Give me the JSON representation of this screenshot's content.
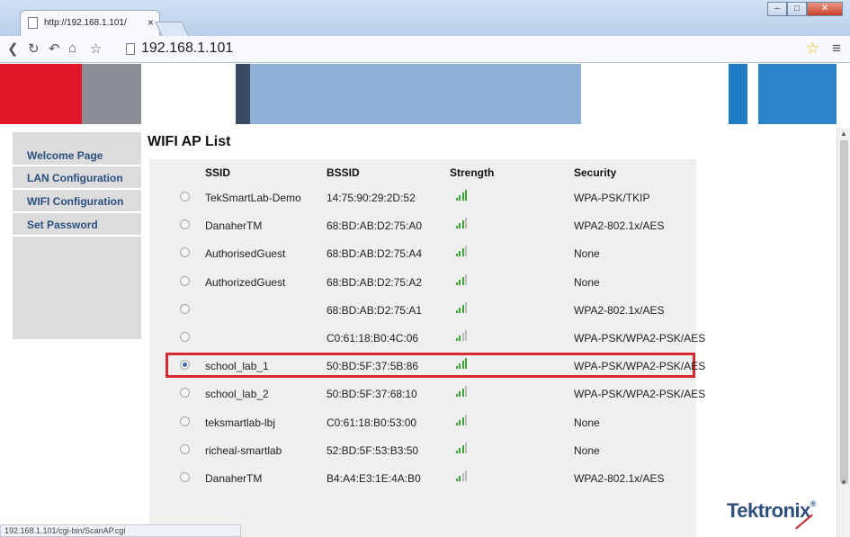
{
  "browser": {
    "tab_title": "http://192.168.1.101/",
    "tab_close": "×",
    "url": "192.168.1.101",
    "status_url": "192.168.1.101/cgi-bin/ScanAP.cgi",
    "icons": [
      "back-icon",
      "reload-icon",
      "undo-icon",
      "home-icon",
      "bookmark-icon",
      "page-icon",
      "star-icon",
      "menu-icon"
    ]
  },
  "sidebar": {
    "items": [
      {
        "label": "Welcome Page"
      },
      {
        "label": "LAN Configuration"
      },
      {
        "label": "WIFI Configuration"
      },
      {
        "label": "Set Password"
      }
    ]
  },
  "page": {
    "title": "WIFI AP List"
  },
  "table": {
    "headers": {
      "ssid": "SSID",
      "bssid": "BSSID",
      "strength": "Strength",
      "security": "Security"
    },
    "rows": [
      {
        "ssid": "TekSmartLab-Demo",
        "bssid": "14:75:90:29:2D:52",
        "strength_bars": 4,
        "security": "WPA-PSK/TKIP",
        "selected": false
      },
      {
        "ssid": "DanaherTM",
        "bssid": "68:BD:AB:D2:75:A0",
        "strength_bars": 3,
        "security": "WPA2-802.1x/AES",
        "selected": false
      },
      {
        "ssid": "AuthorisedGuest",
        "bssid": "68:BD:AB:D2:75:A4",
        "strength_bars": 3,
        "security": "None",
        "selected": false
      },
      {
        "ssid": "AuthorizedGuest",
        "bssid": "68:BD:AB:D2:75:A2",
        "strength_bars": 3,
        "security": "None",
        "selected": false
      },
      {
        "ssid": "",
        "bssid": "68:BD:AB:D2:75:A1",
        "strength_bars": 3,
        "security": "WPA2-802.1x/AES",
        "selected": false
      },
      {
        "ssid": "",
        "bssid": "C0:61:18:B0:4C:06",
        "strength_bars": 2,
        "security": "WPA-PSK/WPA2-PSK/AES",
        "selected": false
      },
      {
        "ssid": "school_lab_1",
        "bssid": "50:BD:5F:37:5B:86",
        "strength_bars": 4,
        "security": "WPA-PSK/WPA2-PSK/AES",
        "selected": true
      },
      {
        "ssid": "school_lab_2",
        "bssid": "50:BD:5F:37:68:10",
        "strength_bars": 3,
        "security": "WPA-PSK/WPA2-PSK/AES",
        "selected": false
      },
      {
        "ssid": "teksmartlab-lbj",
        "bssid": "C0:61:18:B0:53:00",
        "strength_bars": 3,
        "security": "None",
        "selected": false
      },
      {
        "ssid": "richeal-smartlab",
        "bssid": "52:BD:5F:53:B3:50",
        "strength_bars": 3,
        "security": "None",
        "selected": false
      },
      {
        "ssid": "DanaherTM",
        "bssid": "B4:A4:E3:1E:4A:B0",
        "strength_bars": 2,
        "security": "WPA2-802.1x/AES",
        "selected": false
      }
    ]
  },
  "logo": {
    "text": "Tektronix",
    "mark": "®"
  },
  "colors": {
    "accent_red": "#e3172c",
    "signal_green": "#3aa535",
    "highlight_red": "#d42a30",
    "nav_link": "#2a4f80"
  }
}
